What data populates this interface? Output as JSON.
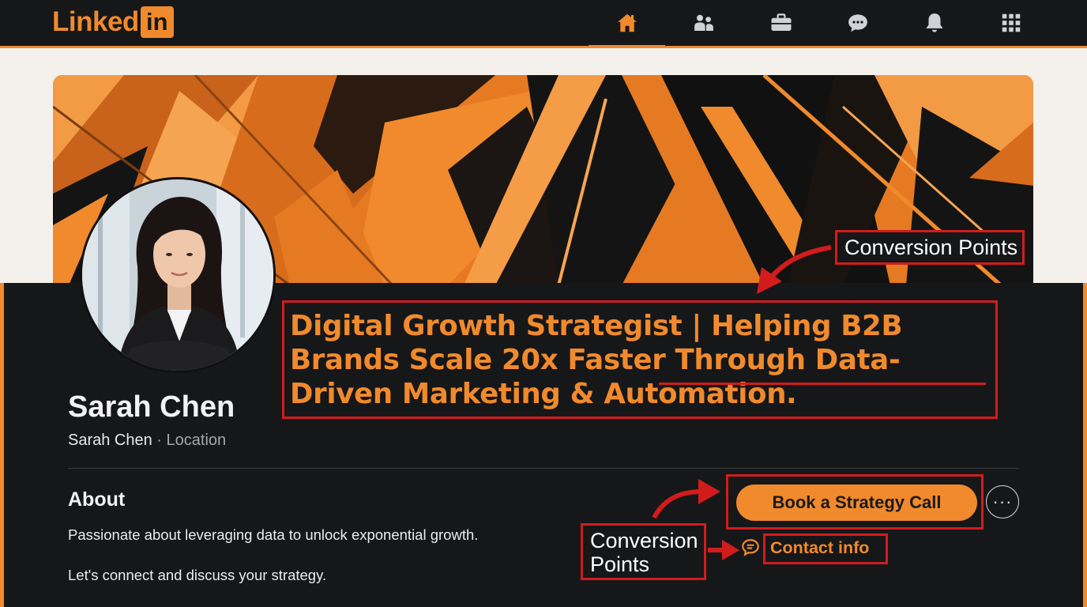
{
  "nav": {
    "logo_word": "Linked",
    "logo_box": "in",
    "items": [
      {
        "icon": "home-icon",
        "active": true
      },
      {
        "icon": "network-icon",
        "active": false
      },
      {
        "icon": "jobs-briefcase-icon",
        "active": false
      },
      {
        "icon": "messaging-icon",
        "active": false
      },
      {
        "icon": "notifications-bell-icon",
        "active": false
      },
      {
        "icon": "apps-grid-icon",
        "active": false
      }
    ]
  },
  "profile": {
    "name": "Sarah Chen",
    "sub_name": "Sarah Chen",
    "separator": " · ",
    "location": "Location",
    "headline": "Digital Growth Strategist | Helping B2B Brands Scale 20x Faster Through Data-Driven Marketing & Automation."
  },
  "about": {
    "title": "About",
    "paragraph1": "Passionate about leveraging data to unlock exponential growth.",
    "paragraph2": "Let's connect and discuss your strategy."
  },
  "actions": {
    "primary_cta": "Book a Strategy Call",
    "more": "···",
    "contact_info": "Contact info"
  },
  "annotations": {
    "top_callout": "Conversion Points",
    "bottom_callout": "Conversion Points"
  },
  "colors": {
    "accent": "#f08a2c",
    "annotation_red": "#d21c1c",
    "panel_bg": "#161719"
  }
}
